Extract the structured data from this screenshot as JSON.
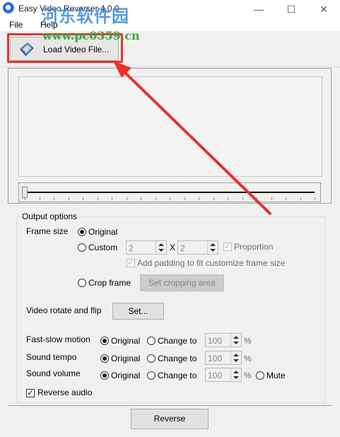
{
  "window": {
    "title": "Easy Video Reverser 4.0.0",
    "minimize": "—",
    "maximize": "☐",
    "close": "✕"
  },
  "watermark": {
    "line1": "河东软件园",
    "line2": "www.pc0359.cn"
  },
  "menu": {
    "file": "File",
    "help": "Help"
  },
  "toolbar": {
    "load_label": "Load Video File..."
  },
  "output": {
    "group_label": "Output options",
    "frame_size_label": "Frame size",
    "original": "Original",
    "custom": "Custom",
    "width": "2",
    "height": "2",
    "x": "X",
    "proportion": "Proportion",
    "add_padding": "Add padding to fit customize frame size",
    "crop_frame": "Crop frame",
    "set_cropping": "Set cropping area",
    "rotate_label": "Video rotate and flip",
    "set_button": "Set...",
    "fast_slow_label": "Fast-slow motion",
    "sound_tempo_label": "Sound tempo",
    "sound_volume_label": "Sound volume",
    "change_to": "Change to",
    "pct": "%",
    "val100": "100",
    "mute": "Mute",
    "reverse_audio": "Reverse audio"
  },
  "reverse_button": "Reverse",
  "colors": {
    "highlight": "#e8312a",
    "watermark_blue": "#3a8ad8",
    "watermark_green": "#3fa63a"
  }
}
